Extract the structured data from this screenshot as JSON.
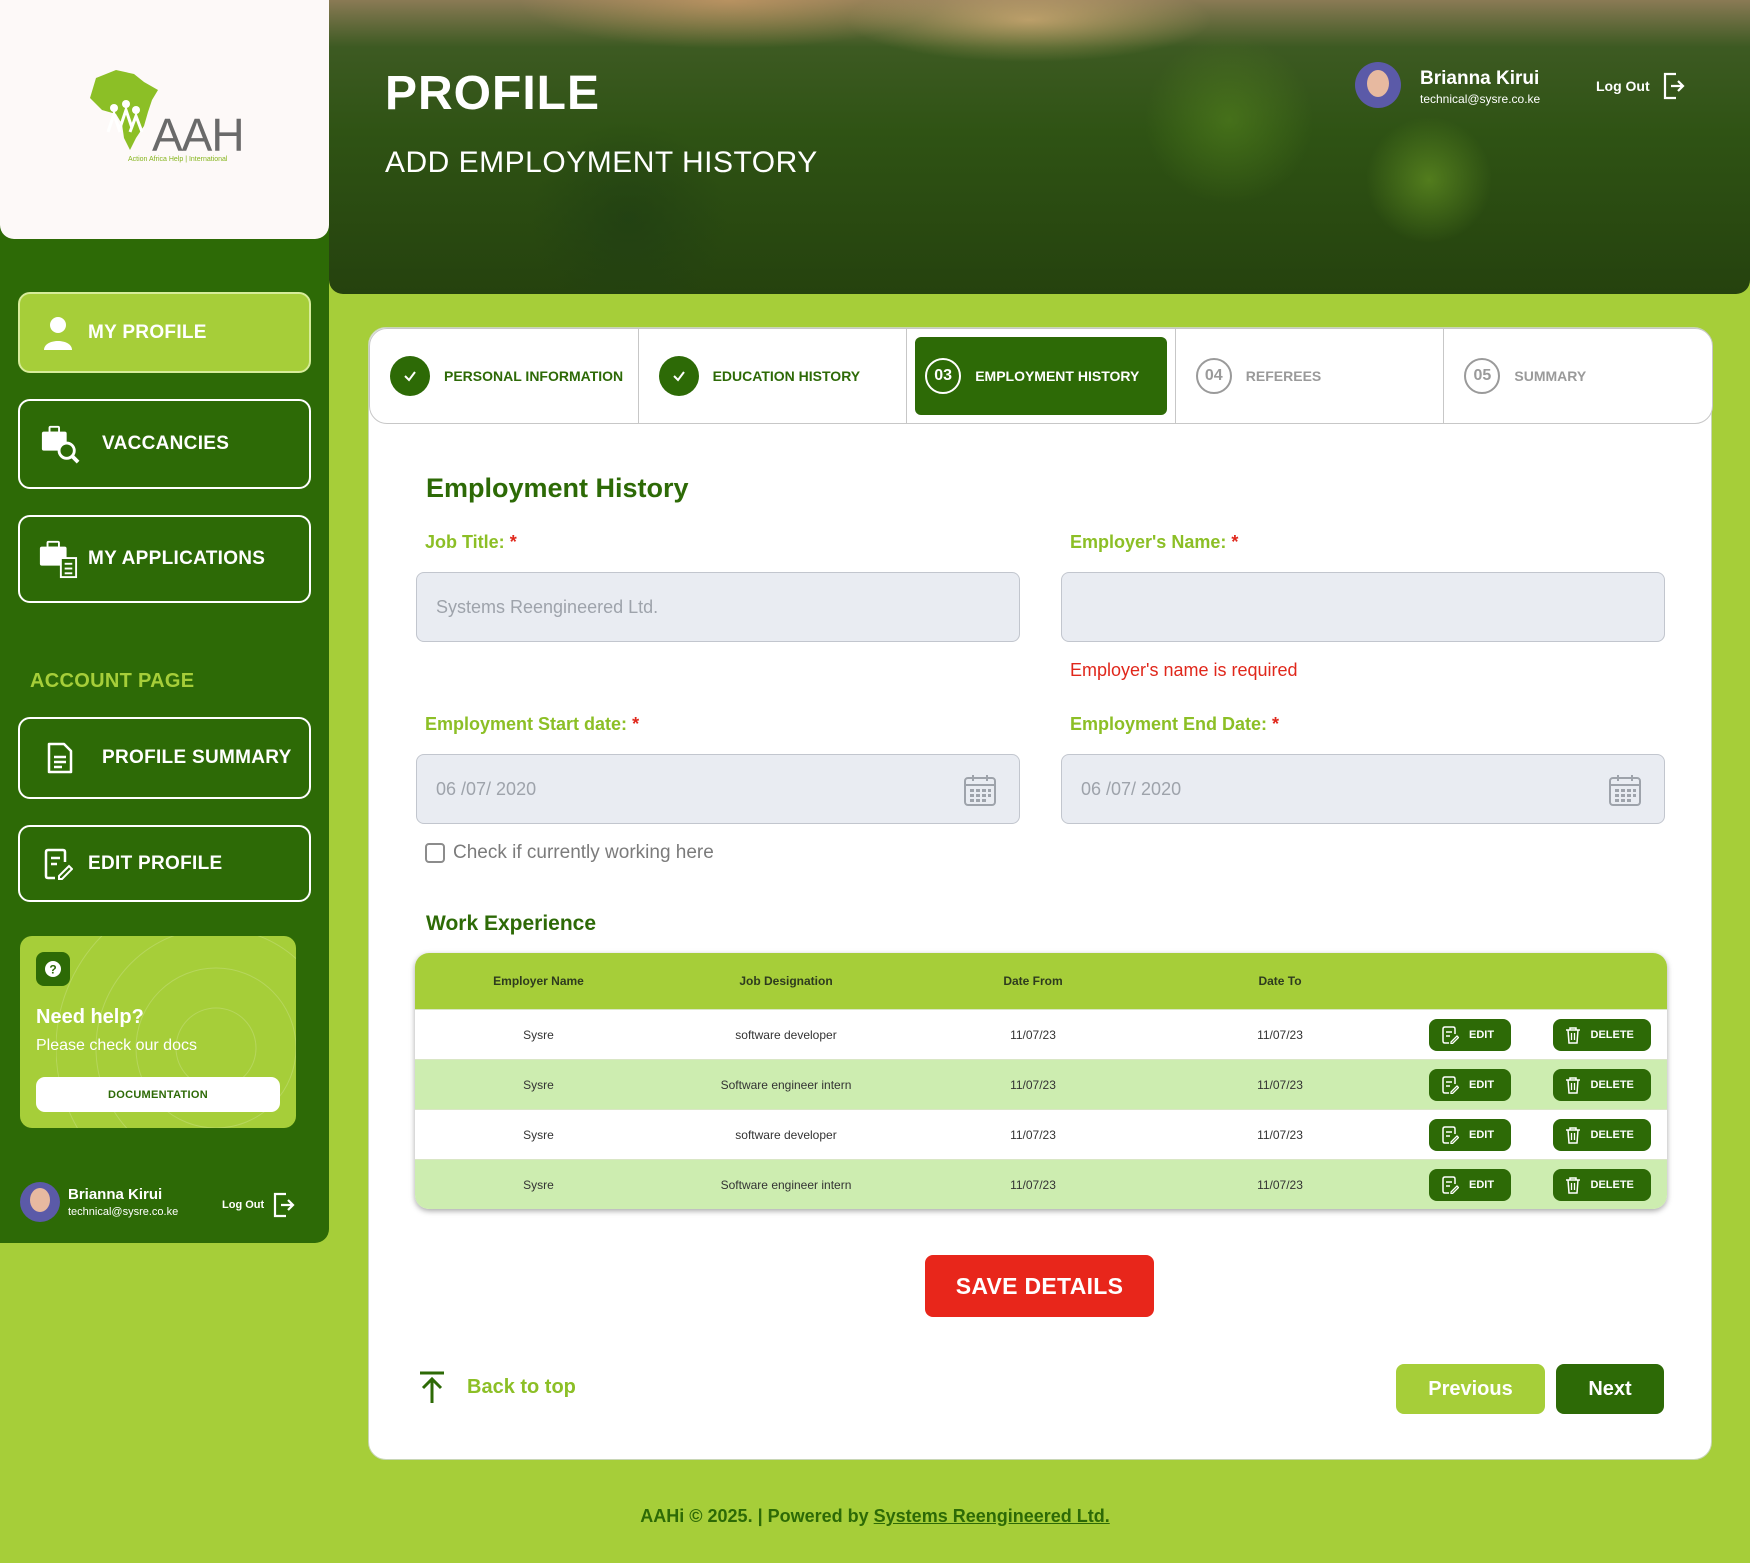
{
  "brand": {
    "logo_text": "AAH",
    "logo_tagline": "Action Africa Help | International"
  },
  "sidebar": {
    "nav": [
      {
        "label": "MY PROFILE",
        "icon": "user-icon",
        "active": true
      },
      {
        "label": "VACCANCIES",
        "icon": "briefcase-search-icon",
        "active": false
      },
      {
        "label": "MY APPLICATIONS",
        "icon": "applications-icon",
        "active": false
      }
    ],
    "account_label": "ACCOUNT PAGE",
    "account_nav": [
      {
        "label": "PROFILE SUMMARY",
        "icon": "document-icon"
      },
      {
        "label": "EDIT PROFILE",
        "icon": "edit-document-icon"
      }
    ],
    "help": {
      "title": "Need help?",
      "subtitle": "Please check our docs",
      "button": "DOCUMENTATION"
    },
    "user": {
      "name": "Brianna Kirui",
      "email": "technical@sysre.co.ke",
      "logout": "Log Out"
    }
  },
  "header": {
    "title": "PROFILE",
    "subtitle": "ADD EMPLOYMENT HISTORY",
    "user_name": "Brianna Kirui",
    "user_email": "technical@sysre.co.ke",
    "logout": "Log Out"
  },
  "stepper": [
    {
      "num": "",
      "label": "PERSONAL INFORMATION",
      "state": "done"
    },
    {
      "num": "",
      "label": "EDUCATION HISTORY",
      "state": "done"
    },
    {
      "num": "03",
      "label": "EMPLOYMENT HISTORY",
      "state": "current"
    },
    {
      "num": "04",
      "label": "REFEREES",
      "state": "todo"
    },
    {
      "num": "05",
      "label": "SUMMARY",
      "state": "todo"
    }
  ],
  "form": {
    "section_title": "Employment History",
    "job_title_label": "Job Title:",
    "job_title_placeholder": "Systems Reengineered Ltd.",
    "employer_label": "Employer's Name:",
    "employer_value": "",
    "employer_error": "Employer's name is required",
    "start_label": "Employment Start date:",
    "start_value": "06 /07/ 2020",
    "end_label": "Employment End Date:",
    "end_value": "06 /07/ 2020",
    "required_mark": "*",
    "current_check_label": "Check if currently working here",
    "current_checked": false
  },
  "work": {
    "title": "Work Experience",
    "columns": [
      "Employer Name",
      "Job Designation",
      "Date From",
      "Date To"
    ],
    "rows": [
      {
        "employer": "Sysre",
        "designation": "software developer",
        "from": "11/07/23",
        "to": "11/07/23"
      },
      {
        "employer": "Sysre",
        "designation": "Software engineer intern",
        "from": "11/07/23",
        "to": "11/07/23"
      },
      {
        "employer": "Sysre",
        "designation": "software developer",
        "from": "11/07/23",
        "to": "11/07/23"
      },
      {
        "employer": "Sysre",
        "designation": "Software engineer intern",
        "from": "11/07/23",
        "to": "11/07/23"
      }
    ],
    "edit_label": "EDIT",
    "delete_label": "DELETE"
  },
  "actions": {
    "save": "SAVE DETAILS",
    "back_to_top": "Back to top",
    "previous": "Previous",
    "next": "Next"
  },
  "footer": {
    "text": "AAHi © 2025. | Powered by ",
    "link": "Systems Reengineered Ltd."
  },
  "colors": {
    "primary_dark": "#2d6a06",
    "primary_light": "#a6ce39",
    "error": "#e0271b",
    "save": "#e8261b"
  }
}
